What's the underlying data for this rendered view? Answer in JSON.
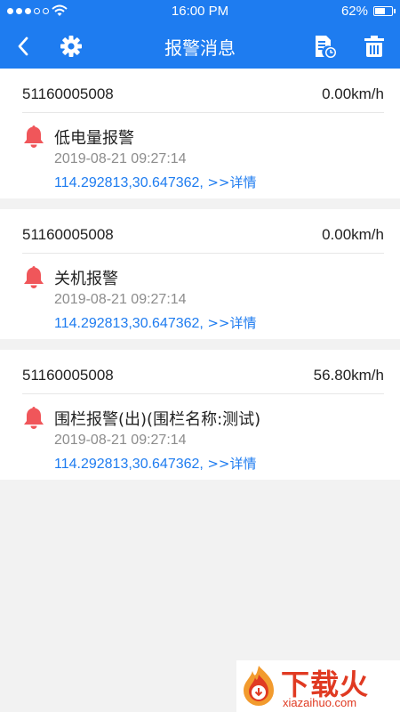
{
  "status_bar": {
    "time": "16:00  PM",
    "battery": "62%",
    "battery_level": 0.62,
    "signal_bars": 3,
    "signal_total": 5
  },
  "navbar": {
    "title": "报警消息",
    "icons": [
      "back-arrow-icon",
      "gear-icon",
      "report-clock-icon",
      "trash-icon"
    ]
  },
  "alarms": [
    {
      "device_id": "51160005008",
      "speed": "0.00km/h",
      "title": "低电量报警",
      "time": "2019-08-21 09:27:14",
      "coords": "114.292813,30.647362, ",
      "details_label": ">>详情"
    },
    {
      "device_id": "51160005008",
      "speed": "0.00km/h",
      "title": "关机报警",
      "time": "2019-08-21 09:27:14",
      "coords": "114.292813,30.647362, ",
      "details_label": ">>详情"
    },
    {
      "device_id": "51160005008",
      "speed": "56.80km/h",
      "title": "围栏报警(出)(围栏名称:测试)",
      "time": "2019-08-21 09:27:14",
      "coords": "114.292813,30.647362, ",
      "details_label": ">>详情"
    }
  ],
  "colors": {
    "primary": "#1E7CF0",
    "bell": "#F0565A",
    "time_text": "#8C8C8C",
    "watermark": "#E03A22"
  },
  "watermark": {
    "text": "下载火",
    "url": "xiazaihuo.com"
  }
}
